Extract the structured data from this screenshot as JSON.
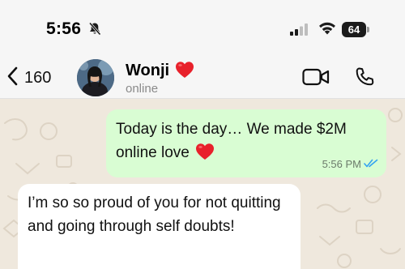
{
  "status_bar": {
    "time": "5:56",
    "battery": "64",
    "icons": [
      "bell-off-icon",
      "signal-icon",
      "wifi-icon",
      "battery-icon"
    ]
  },
  "header": {
    "back_count": "160",
    "contact_name": "Wonji",
    "contact_status": "online",
    "icons": [
      "chevron-left-icon",
      "heart-emoji",
      "video-call-icon",
      "phone-call-icon"
    ]
  },
  "messages": [
    {
      "direction": "outgoing",
      "text": "Today is the day… We made $2M online love",
      "emoji": "red-heart",
      "time": "5:56 PM",
      "status": "read"
    },
    {
      "direction": "incoming",
      "text": "I’m so so proud of you for not quitting and going through self doubts!"
    }
  ],
  "colors": {
    "chat_background": "#efe8dd",
    "outgoing_bubble": "#d9fdd3",
    "incoming_bubble": "#ffffff",
    "read_ticks": "#34a3f1",
    "heart": "#e8212b"
  }
}
